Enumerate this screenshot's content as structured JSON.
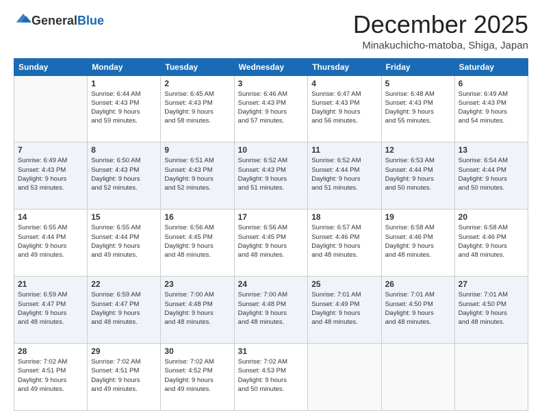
{
  "logo": {
    "general": "General",
    "blue": "Blue"
  },
  "header": {
    "month": "December 2025",
    "location": "Minakuchicho-matoba, Shiga, Japan"
  },
  "weekdays": [
    "Sunday",
    "Monday",
    "Tuesday",
    "Wednesday",
    "Thursday",
    "Friday",
    "Saturday"
  ],
  "weeks": [
    [
      {
        "day": "",
        "info": ""
      },
      {
        "day": "1",
        "info": "Sunrise: 6:44 AM\nSunset: 4:43 PM\nDaylight: 9 hours\nand 59 minutes."
      },
      {
        "day": "2",
        "info": "Sunrise: 6:45 AM\nSunset: 4:43 PM\nDaylight: 9 hours\nand 58 minutes."
      },
      {
        "day": "3",
        "info": "Sunrise: 6:46 AM\nSunset: 4:43 PM\nDaylight: 9 hours\nand 57 minutes."
      },
      {
        "day": "4",
        "info": "Sunrise: 6:47 AM\nSunset: 4:43 PM\nDaylight: 9 hours\nand 56 minutes."
      },
      {
        "day": "5",
        "info": "Sunrise: 6:48 AM\nSunset: 4:43 PM\nDaylight: 9 hours\nand 55 minutes."
      },
      {
        "day": "6",
        "info": "Sunrise: 6:49 AM\nSunset: 4:43 PM\nDaylight: 9 hours\nand 54 minutes."
      }
    ],
    [
      {
        "day": "7",
        "info": "Sunrise: 6:49 AM\nSunset: 4:43 PM\nDaylight: 9 hours\nand 53 minutes."
      },
      {
        "day": "8",
        "info": "Sunrise: 6:50 AM\nSunset: 4:43 PM\nDaylight: 9 hours\nand 52 minutes."
      },
      {
        "day": "9",
        "info": "Sunrise: 6:51 AM\nSunset: 4:43 PM\nDaylight: 9 hours\nand 52 minutes."
      },
      {
        "day": "10",
        "info": "Sunrise: 6:52 AM\nSunset: 4:43 PM\nDaylight: 9 hours\nand 51 minutes."
      },
      {
        "day": "11",
        "info": "Sunrise: 6:52 AM\nSunset: 4:44 PM\nDaylight: 9 hours\nand 51 minutes."
      },
      {
        "day": "12",
        "info": "Sunrise: 6:53 AM\nSunset: 4:44 PM\nDaylight: 9 hours\nand 50 minutes."
      },
      {
        "day": "13",
        "info": "Sunrise: 6:54 AM\nSunset: 4:44 PM\nDaylight: 9 hours\nand 50 minutes."
      }
    ],
    [
      {
        "day": "14",
        "info": "Sunrise: 6:55 AM\nSunset: 4:44 PM\nDaylight: 9 hours\nand 49 minutes."
      },
      {
        "day": "15",
        "info": "Sunrise: 6:55 AM\nSunset: 4:44 PM\nDaylight: 9 hours\nand 49 minutes."
      },
      {
        "day": "16",
        "info": "Sunrise: 6:56 AM\nSunset: 4:45 PM\nDaylight: 9 hours\nand 48 minutes."
      },
      {
        "day": "17",
        "info": "Sunrise: 6:56 AM\nSunset: 4:45 PM\nDaylight: 9 hours\nand 48 minutes."
      },
      {
        "day": "18",
        "info": "Sunrise: 6:57 AM\nSunset: 4:46 PM\nDaylight: 9 hours\nand 48 minutes."
      },
      {
        "day": "19",
        "info": "Sunrise: 6:58 AM\nSunset: 4:46 PM\nDaylight: 9 hours\nand 48 minutes."
      },
      {
        "day": "20",
        "info": "Sunrise: 6:58 AM\nSunset: 4:46 PM\nDaylight: 9 hours\nand 48 minutes."
      }
    ],
    [
      {
        "day": "21",
        "info": "Sunrise: 6:59 AM\nSunset: 4:47 PM\nDaylight: 9 hours\nand 48 minutes."
      },
      {
        "day": "22",
        "info": "Sunrise: 6:59 AM\nSunset: 4:47 PM\nDaylight: 9 hours\nand 48 minutes."
      },
      {
        "day": "23",
        "info": "Sunrise: 7:00 AM\nSunset: 4:48 PM\nDaylight: 9 hours\nand 48 minutes."
      },
      {
        "day": "24",
        "info": "Sunrise: 7:00 AM\nSunset: 4:48 PM\nDaylight: 9 hours\nand 48 minutes."
      },
      {
        "day": "25",
        "info": "Sunrise: 7:01 AM\nSunset: 4:49 PM\nDaylight: 9 hours\nand 48 minutes."
      },
      {
        "day": "26",
        "info": "Sunrise: 7:01 AM\nSunset: 4:50 PM\nDaylight: 9 hours\nand 48 minutes."
      },
      {
        "day": "27",
        "info": "Sunrise: 7:01 AM\nSunset: 4:50 PM\nDaylight: 9 hours\nand 48 minutes."
      }
    ],
    [
      {
        "day": "28",
        "info": "Sunrise: 7:02 AM\nSunset: 4:51 PM\nDaylight: 9 hours\nand 49 minutes."
      },
      {
        "day": "29",
        "info": "Sunrise: 7:02 AM\nSunset: 4:51 PM\nDaylight: 9 hours\nand 49 minutes."
      },
      {
        "day": "30",
        "info": "Sunrise: 7:02 AM\nSunset: 4:52 PM\nDaylight: 9 hours\nand 49 minutes."
      },
      {
        "day": "31",
        "info": "Sunrise: 7:02 AM\nSunset: 4:53 PM\nDaylight: 9 hours\nand 50 minutes."
      },
      {
        "day": "",
        "info": ""
      },
      {
        "day": "",
        "info": ""
      },
      {
        "day": "",
        "info": ""
      }
    ]
  ]
}
